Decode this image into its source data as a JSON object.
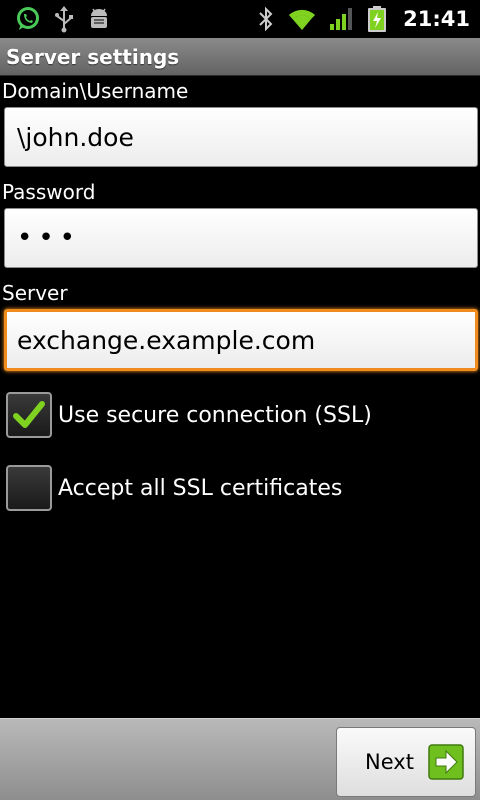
{
  "status_bar": {
    "time": "21:41",
    "icons": [
      "whatsapp-icon",
      "usb-icon",
      "android-debug-icon",
      "bluetooth-icon",
      "wifi-icon",
      "signal-icon",
      "battery-charging-icon"
    ],
    "colors": {
      "accent_green": "#7fd320",
      "whatsapp_green": "#4ac959"
    }
  },
  "title_bar": {
    "title": "Server settings"
  },
  "form": {
    "domain_label": "Domain\\Username",
    "domain_value": "\\john.doe",
    "password_label": "Password",
    "password_value": "•••",
    "server_label": "Server",
    "server_value": "exchange.example.com",
    "ssl_label": "Use secure connection (SSL)",
    "ssl_checked": true,
    "accept_certs_label": "Accept all SSL certificates",
    "accept_certs_checked": false,
    "focus_color": "#f08c1e"
  },
  "bottom_bar": {
    "next_label": "Next"
  }
}
